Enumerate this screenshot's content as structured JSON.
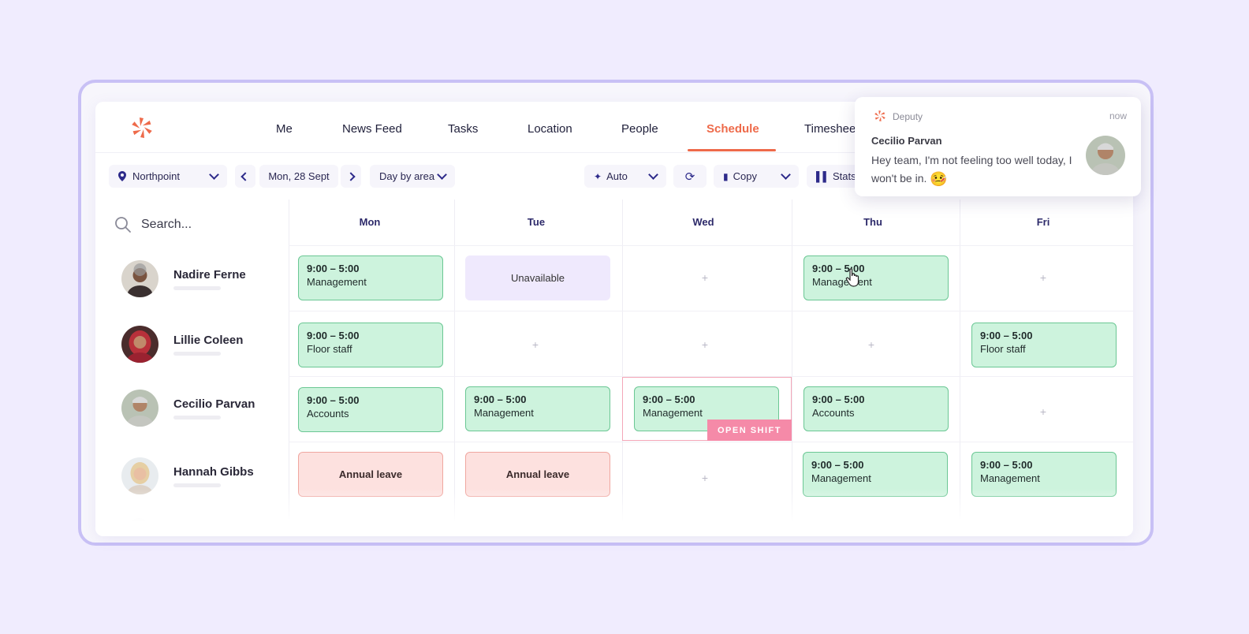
{
  "nav": {
    "items": [
      {
        "label": "Me"
      },
      {
        "label": "News Feed"
      },
      {
        "label": "Tasks"
      },
      {
        "label": "Location"
      },
      {
        "label": "People"
      },
      {
        "label": "Schedule",
        "active": true
      },
      {
        "label": "Timesheets"
      }
    ]
  },
  "toolbar": {
    "location": "Northpoint",
    "date": "Mon, 28 Sept",
    "view": "Day by area",
    "auto": "Auto",
    "copy": "Copy",
    "stats": "Stats"
  },
  "search": {
    "placeholder": "Search..."
  },
  "days": [
    "Mon",
    "Tue",
    "Wed",
    "Thu",
    "Fri"
  ],
  "people": [
    {
      "name": "Nadire Ferne"
    },
    {
      "name": "Lillie Coleen"
    },
    {
      "name": "Cecilio Parvan"
    },
    {
      "name": "Hannah Gibbs"
    }
  ],
  "cells": {
    "r0": {
      "mon": {
        "time": "9:00 – 5:00",
        "role": "Management"
      },
      "tue": "Unavailable",
      "thu": {
        "time": "9:00 – 5:00",
        "role": "Management"
      }
    },
    "r1": {
      "mon": {
        "time": "9:00 – 5:00",
        "role": "Floor staff"
      },
      "fri": {
        "time": "9:00 – 5:00",
        "role": "Floor staff"
      }
    },
    "r2": {
      "mon": {
        "time": "9:00 – 5:00",
        "role": "Accounts"
      },
      "tue": {
        "time": "9:00 – 5:00",
        "role": "Management"
      },
      "wed": {
        "time": "9:00 – 5:00",
        "role": "Management"
      },
      "thu": {
        "time": "9:00 – 5:00",
        "role": "Accounts"
      }
    },
    "r3": {
      "mon": "Annual leave",
      "tue": "Annual leave",
      "thu": {
        "time": "9:00 – 5:00",
        "role": "Management"
      },
      "fri": {
        "time": "9:00 – 5:00",
        "role": "Management"
      }
    }
  },
  "open_shift_label": "OPEN SHIFT",
  "plus_symbol": "+",
  "notification": {
    "app": "Deputy",
    "time": "now",
    "sender": "Cecilio Parvan",
    "message": "Hey team, I'm not feeling too well today, I won't be in.",
    "emoji": "🤒"
  },
  "colors": {
    "accent": "#ee6a4a",
    "shift_bg": "#cdf3dd",
    "leave_bg": "#fde1df",
    "unavailable_bg": "#efe9fd",
    "open_shift": "#f58aa8"
  }
}
